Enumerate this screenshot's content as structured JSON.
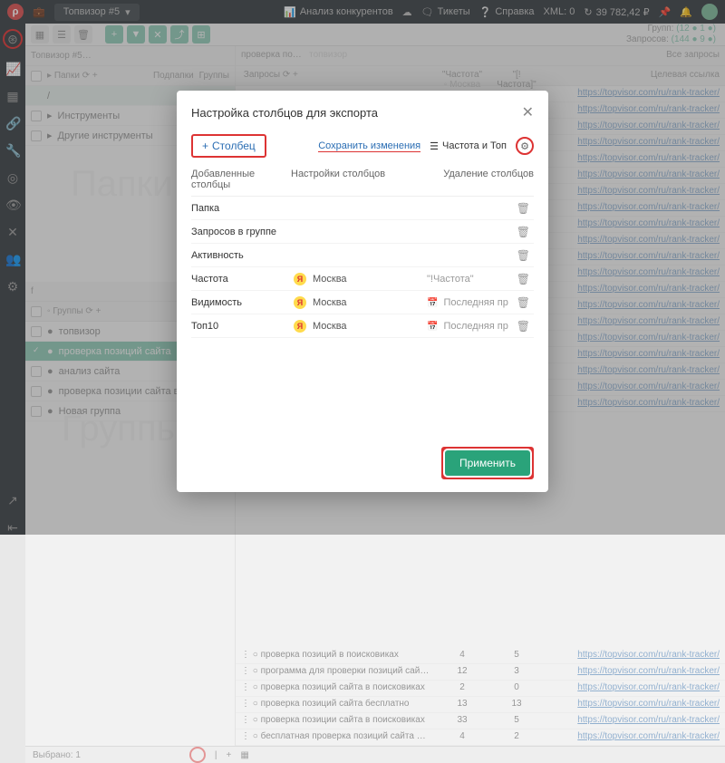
{
  "topbar": {
    "project": "Топвизор #5",
    "competitors": "Анализ конкурентов",
    "tickets": "Тикеты",
    "help": "Справка",
    "xml": "XML: 0",
    "balance": "39 782,42 ₽"
  },
  "stats": {
    "groups_label": "Групп:",
    "groups": "(12 ● 1 ●)",
    "queries_label": "Запросов:",
    "queries": "(144 ● 9 ●)"
  },
  "left": {
    "tab": "Топвизор #5…",
    "papki": "Папки",
    "podpapki": "Подпапки",
    "gruppy": "Группы",
    "folders": [
      "/",
      "Инструменты",
      "Другие инструменты"
    ],
    "wm1": "Папки",
    "f_hdr": "f",
    "grp_label": "Группы",
    "groups": [
      "топвизор",
      "проверка позиций сайта",
      "анализ сайта",
      "проверка позиции сайта в…",
      "Новая группа"
    ],
    "wm2": "Группы",
    "selected": "Выбрано: 1"
  },
  "right": {
    "tab1": "проверка по…",
    "tab2": "топвизор",
    "all": "Все запросы",
    "zaprosy": "Запросы",
    "h1": "\"Частота\"",
    "h2": "\"[!Частота]\"",
    "h1b": "Москва",
    "h2b": "Москва",
    "h3": "Целевая ссылка",
    "link": "https://topvisor.com/ru/rank-tracker/",
    "rows": [
      {
        "q": "проверка позиций в поисковиках",
        "a": "4",
        "b": "5"
      },
      {
        "q": "программа для проверки позиций сайта в поис…",
        "a": "12",
        "b": "3"
      },
      {
        "q": "проверка позиций сайта в поисковиках",
        "a": "2",
        "b": "0"
      },
      {
        "q": "проверка позиций сайта бесплатно",
        "a": "13",
        "b": "13"
      },
      {
        "q": "проверка позиции сайта в поисковиках",
        "a": "33",
        "b": "5"
      },
      {
        "q": "бесплатная проверка позиций сайта в поисков…",
        "a": "4",
        "b": "2"
      }
    ]
  },
  "modal": {
    "title": "Настройка столбцов для экспорта",
    "add": "Столбец",
    "save": "Сохранить изменения",
    "freq": "Частота и Топ",
    "hdr1": "Добавленные столбцы",
    "hdr2": "Настройки столбцов",
    "hdr3": "Удаление столбцов",
    "rows": [
      {
        "name": "Папка",
        "badge": "",
        "city": "",
        "extra": "",
        "del": true
      },
      {
        "name": "Запросов в группе",
        "badge": "",
        "city": "",
        "extra": "",
        "del": true
      },
      {
        "name": "Активность",
        "badge": "",
        "city": "",
        "extra": "",
        "del": true
      },
      {
        "name": "Частота",
        "badge": "Я",
        "city": "Москва",
        "extra": "\"!Частота\"",
        "del": true
      },
      {
        "name": "Видимость",
        "badge": "Я",
        "city": "Москва",
        "extra": "Последняя пр",
        "cal": true,
        "del": true
      },
      {
        "name": "Топ10",
        "badge": "Я",
        "city": "Москва",
        "extra": "Последняя пр",
        "cal": true,
        "del": true
      }
    ],
    "apply": "Применить"
  }
}
